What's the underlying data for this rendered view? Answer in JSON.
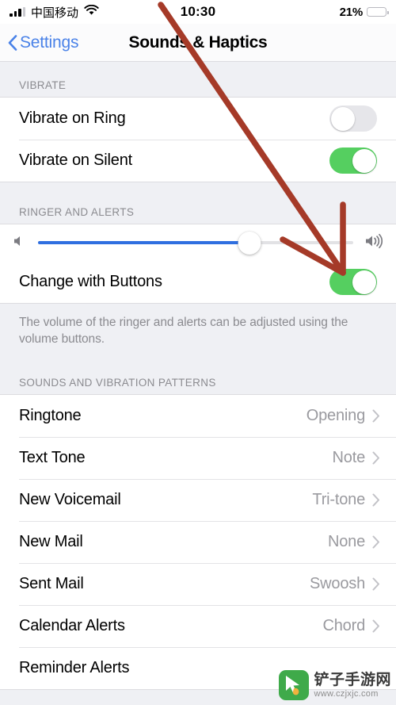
{
  "status_bar": {
    "carrier": "中国移动",
    "time": "10:30",
    "battery_percent": "21%",
    "battery_level": 21,
    "signal_bars_filled": 3,
    "signal_bars_total": 4,
    "wifi_icon": "wifi-icon",
    "battery_icon": "battery-icon",
    "battery_color": "#f5ce43"
  },
  "nav": {
    "back_label": "Settings",
    "back_icon": "chevron-left-icon",
    "title": "Sounds & Haptics",
    "accent_color": "#4a82e8"
  },
  "sections": {
    "vibrate": {
      "header": "VIBRATE",
      "rows": [
        {
          "label": "Vibrate on Ring",
          "toggle": "off"
        },
        {
          "label": "Vibrate on Silent",
          "toggle": "on"
        }
      ]
    },
    "ringer": {
      "header": "RINGER AND ALERTS",
      "slider": {
        "value": 67,
        "min": 0,
        "max": 100,
        "left_icon": "speaker-low-icon",
        "right_icon": "speaker-high-icon",
        "fill_color": "#2f6fe0"
      },
      "change_with_buttons": {
        "label": "Change with Buttons",
        "toggle": "on"
      },
      "footnote": "The volume of the ringer and alerts can be adjusted using the volume buttons."
    },
    "patterns": {
      "header": "SOUNDS AND VIBRATION PATTERNS",
      "rows": [
        {
          "label": "Ringtone",
          "value": "Opening"
        },
        {
          "label": "Text Tone",
          "value": "Note"
        },
        {
          "label": "New Voicemail",
          "value": "Tri-tone"
        },
        {
          "label": "New Mail",
          "value": "None"
        },
        {
          "label": "Sent Mail",
          "value": "Swoosh"
        },
        {
          "label": "Calendar Alerts",
          "value": "Chord"
        },
        {
          "label": "Reminder Alerts",
          "value": ""
        }
      ]
    }
  },
  "annotation": {
    "type": "arrow",
    "color": "#a53a28",
    "description": "hand-drawn red arrow pointing to the right end of the ringer volume slider"
  },
  "watermark": {
    "site_name": "铲子手游网",
    "url": "www.czjxjc.com",
    "logo_icon": "cursor-pointer-icon",
    "logo_color": "#3faa4a"
  },
  "toggle_colors": {
    "on": "#55cf60",
    "off": "#e6e6ea"
  }
}
